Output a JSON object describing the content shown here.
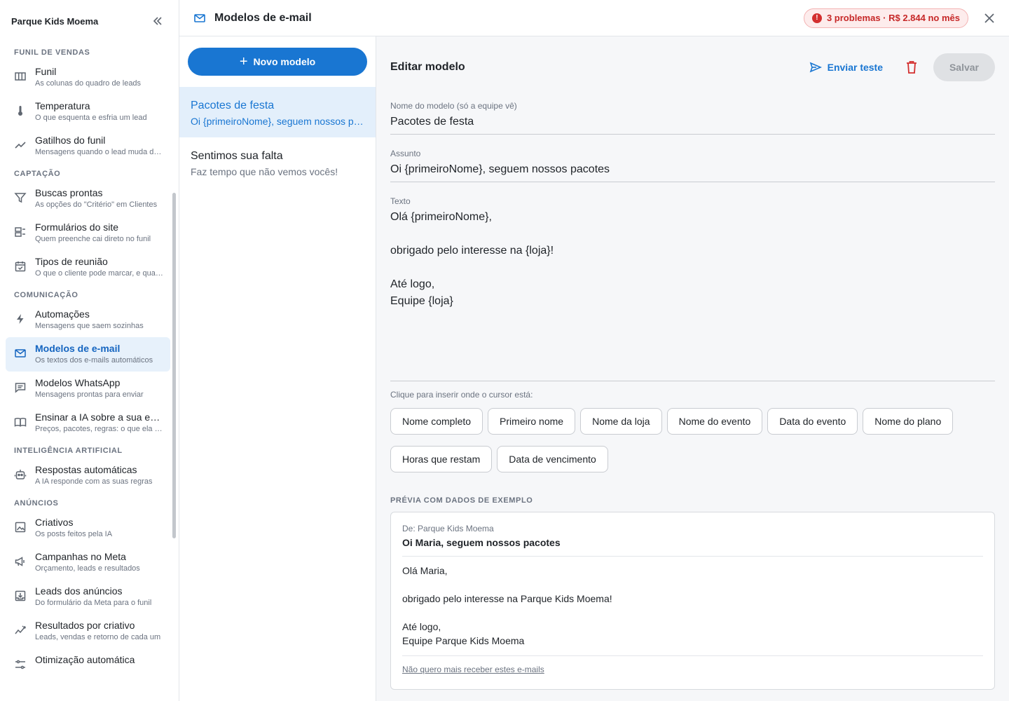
{
  "app": {
    "org_name": "Parque Kids Moema"
  },
  "sidebar": {
    "sections": [
      {
        "label": "FUNIL DE VENDAS",
        "items": [
          {
            "title": "Funil",
            "subtitle": "As colunas do quadro de leads",
            "icon": "columns-icon"
          },
          {
            "title": "Temperatura",
            "subtitle": "O que esquenta e esfria um lead",
            "icon": "thermometer-icon"
          },
          {
            "title": "Gatilhos do funil",
            "subtitle": "Mensagens quando o lead muda de etapa",
            "icon": "trending-icon"
          }
        ]
      },
      {
        "label": "CAPTAÇÃO",
        "items": [
          {
            "title": "Buscas prontas",
            "subtitle": "As opções do \"Critério\" em Clientes",
            "icon": "filter-icon"
          },
          {
            "title": "Formulários do site",
            "subtitle": "Quem preenche cai direto no funil",
            "icon": "form-icon"
          },
          {
            "title": "Tipos de reunião",
            "subtitle": "O que o cliente pode marcar, e quando",
            "icon": "calendar-check-icon"
          }
        ]
      },
      {
        "label": "COMUNICAÇÃO",
        "items": [
          {
            "title": "Automações",
            "subtitle": "Mensagens que saem sozinhas",
            "icon": "bolt-icon"
          },
          {
            "title": "Modelos de e-mail",
            "subtitle": "Os textos dos e-mails automáticos",
            "icon": "mail-icon",
            "active": true
          },
          {
            "title": "Modelos WhatsApp",
            "subtitle": "Mensagens prontas para enviar",
            "icon": "chat-icon"
          },
          {
            "title": "Ensinar a IA sobre a sua empresa",
            "subtitle": "Preços, pacotes, regras: o que ela precisa saber",
            "icon": "book-icon"
          }
        ]
      },
      {
        "label": "INTELIGÊNCIA ARTIFICIAL",
        "items": [
          {
            "title": "Respostas automáticas",
            "subtitle": "A IA responde com as suas regras",
            "icon": "robot-icon"
          }
        ]
      },
      {
        "label": "ANÚNCIOS",
        "items": [
          {
            "title": "Criativos",
            "subtitle": "Os posts feitos pela IA",
            "icon": "image-icon"
          },
          {
            "title": "Campanhas no Meta",
            "subtitle": "Orçamento, leads e resultados",
            "icon": "megaphone-icon"
          },
          {
            "title": "Leads dos anúncios",
            "subtitle": "Do formulário da Meta para o funil",
            "icon": "inbox-download-icon"
          },
          {
            "title": "Resultados por criativo",
            "subtitle": "Leads, vendas e retorno de cada um",
            "icon": "analytics-icon"
          },
          {
            "title": "Otimização automática",
            "subtitle": "",
            "icon": "tune-icon"
          }
        ]
      }
    ]
  },
  "topbar": {
    "title": "Modelos de e-mail",
    "problems_badge": "3 problemas · R$ 2.844 no mês"
  },
  "templates": {
    "new_button": "Novo modelo",
    "items": [
      {
        "name": "Pacotes de festa",
        "preview": "Oi {primeiroNome}, seguem nossos pacotes",
        "selected": true
      },
      {
        "name": "Sentimos sua falta",
        "preview": "Faz tempo que não vemos vocês!"
      }
    ]
  },
  "editor": {
    "title": "Editar modelo",
    "send_test": "Enviar teste",
    "save": "Salvar",
    "name_label": "Nome do modelo (só a equipe vê)",
    "name_value": "Pacotes de festa",
    "subject_label": "Assunto",
    "subject_value": "Oi {primeiroNome}, seguem nossos pacotes",
    "body_label": "Texto",
    "body_value": "Olá {primeiroNome},\n\nobrigado pelo interesse na {loja}!\n\nAté logo,\nEquipe {loja}",
    "insert_hint": "Clique para inserir onde o cursor está:",
    "chips": [
      "Nome completo",
      "Primeiro nome",
      "Nome da loja",
      "Nome do evento",
      "Data do evento",
      "Nome do plano",
      "Horas que restam",
      "Data de vencimento"
    ],
    "preview_label": "PRÉVIA COM DADOS DE EXEMPLO",
    "preview": {
      "from": "De: Parque Kids Moema",
      "subject": "Oi Maria, seguem nossos pacotes",
      "body": "Olá Maria,\n\nobrigado pelo interesse na Parque Kids Moema!\n\nAté logo,\nEquipe Parque Kids Moema",
      "unsubscribe": "Não quero mais receber estes e-mails"
    }
  },
  "colors": {
    "accent": "#1976d2",
    "danger": "#d32f2f",
    "active_bg": "#e7f1fb"
  }
}
